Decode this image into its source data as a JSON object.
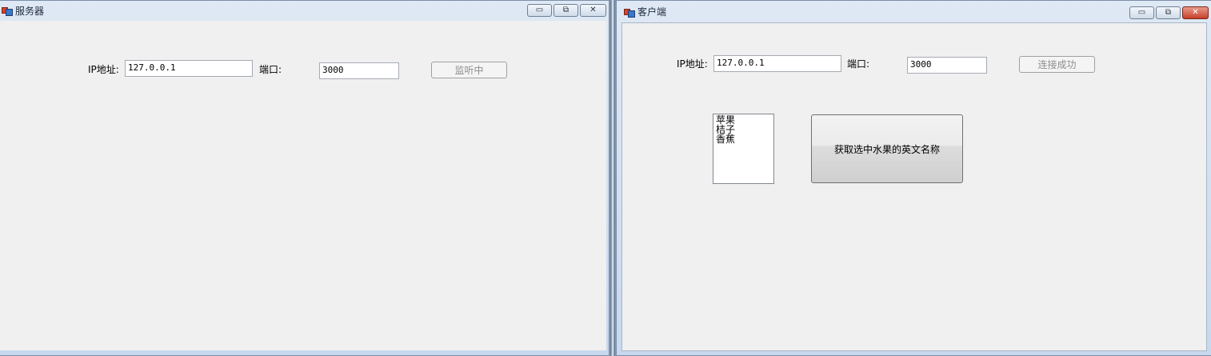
{
  "server": {
    "title": "服务器",
    "ip_label": "IP地址:",
    "ip_value": "127.0.0.1",
    "port_label": "端口:",
    "port_value": "3000",
    "listen_button": "监听中"
  },
  "client": {
    "title": "客户端",
    "ip_label": "IP地址:",
    "ip_value": "127.0.0.1",
    "port_label": "端口:",
    "port_value": "3000",
    "connect_button": "连接成功",
    "fruits": [
      "苹果",
      "桔子",
      "香蕉"
    ],
    "get_button": "获取选中水果的英文名称"
  },
  "caption_icons": [
    "minimize-icon",
    "restore-icon",
    "close-icon"
  ]
}
